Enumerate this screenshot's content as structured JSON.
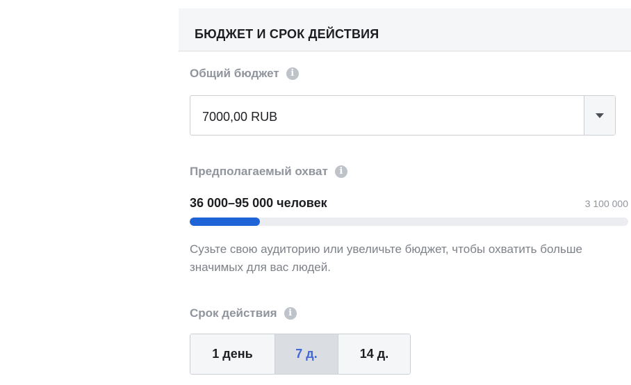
{
  "section": {
    "title": "БЮДЖЕТ И СРОК ДЕЙСТВИЯ"
  },
  "budget": {
    "label": "Общий бюджет",
    "value": "7000,00 RUB",
    "info_icon": "info-icon"
  },
  "reach": {
    "label": "Предполагаемый охват",
    "range": "36 000–95 000 человек",
    "max": "3 100 000",
    "progress_fraction": 0.16,
    "bar_color": "#1e64d6",
    "hint": "Сузьте свою аудиторию или увеличьте бюджет, чтобы охватить больше значимых для вас людей."
  },
  "duration": {
    "label": "Срок действия",
    "options": [
      "1 день",
      "7 д.",
      "14 д."
    ],
    "selected": "7 д.",
    "accent_color": "#4267d6"
  }
}
